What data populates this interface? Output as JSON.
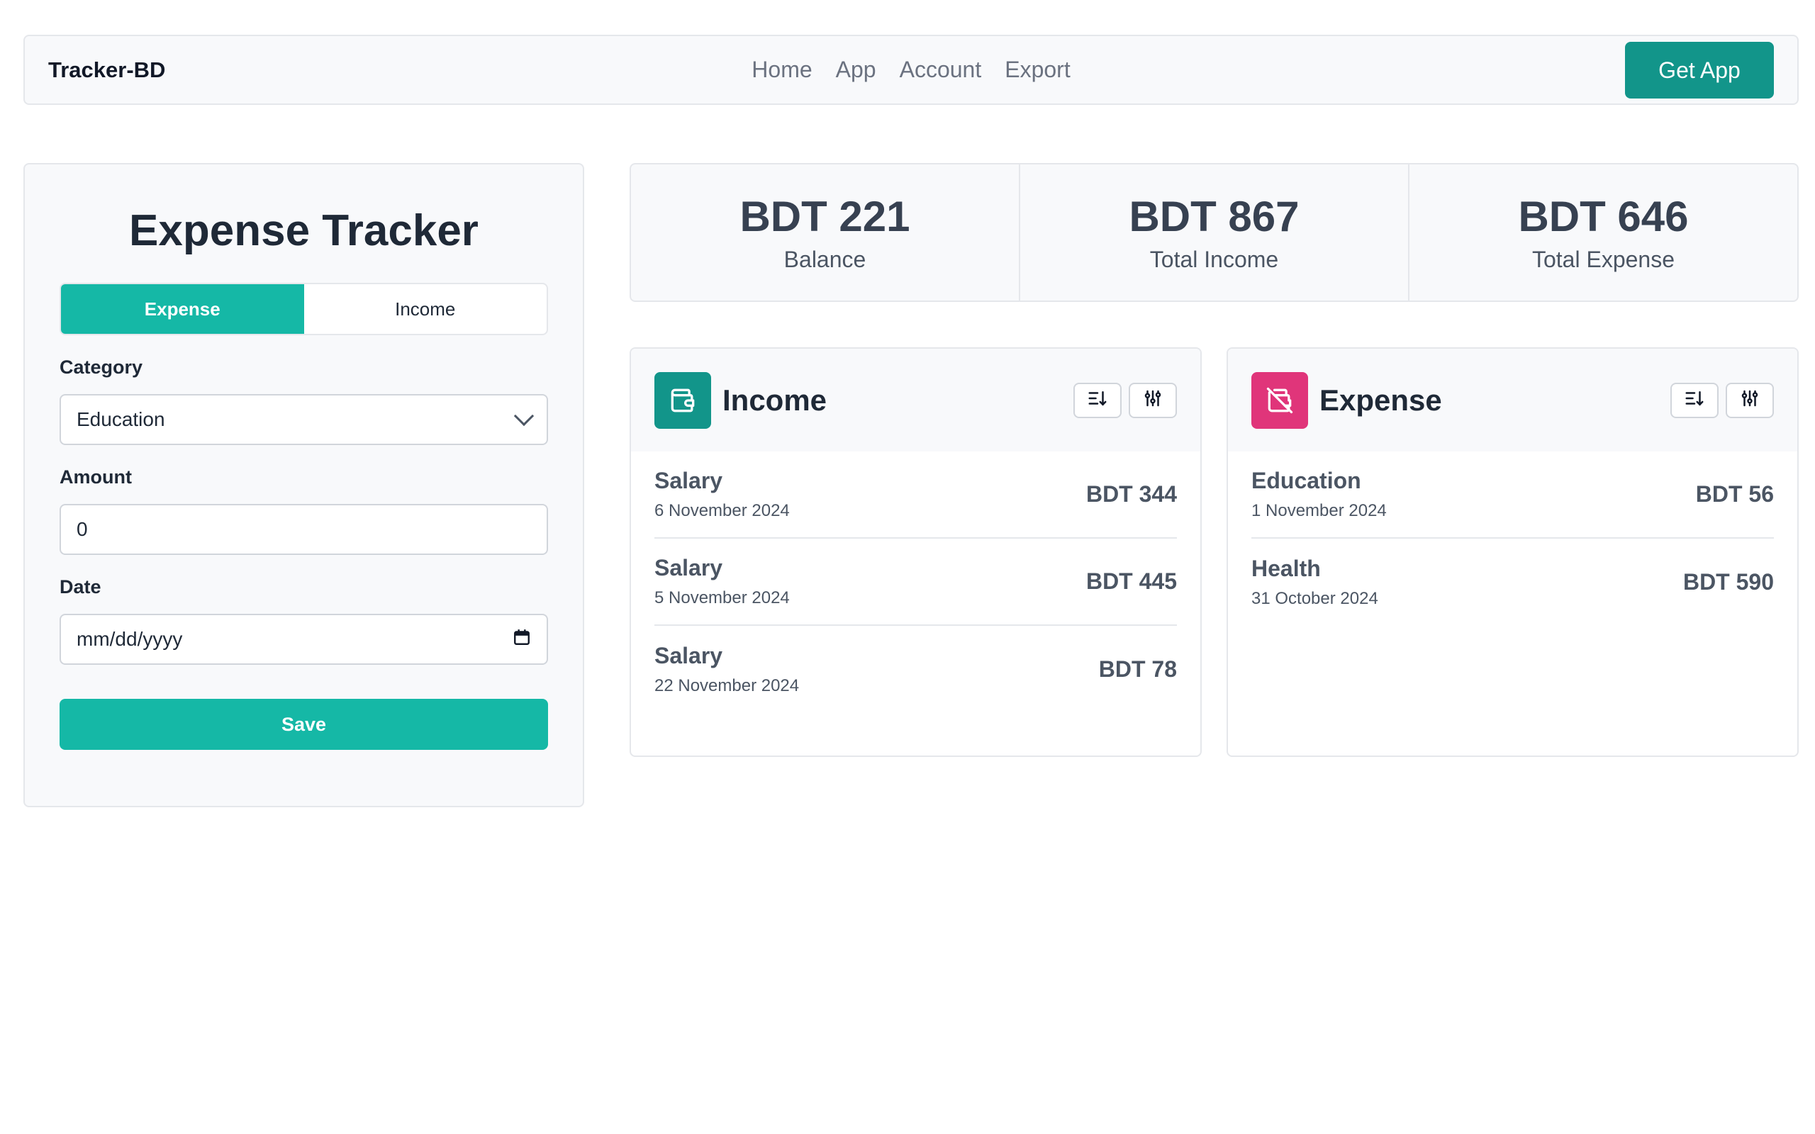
{
  "nav": {
    "brand": "Tracker-BD",
    "links": [
      "Home",
      "App",
      "Account",
      "Export"
    ],
    "cta": "Get App"
  },
  "form": {
    "title": "Expense Tracker",
    "tabs": [
      {
        "label": "Expense",
        "active": true
      },
      {
        "label": "Income",
        "active": false
      }
    ],
    "category_label": "Category",
    "category_value": "Education",
    "amount_label": "Amount",
    "amount_value": "0",
    "date_label": "Date",
    "date_placeholder": "mm/dd/yyyy",
    "save_label": "Save"
  },
  "stats": [
    {
      "value": "BDT 221",
      "label": "Balance"
    },
    {
      "value": "BDT 867",
      "label": "Total Income"
    },
    {
      "value": "BDT 646",
      "label": "Total Expense"
    }
  ],
  "income": {
    "title": "Income",
    "icon": "wallet-icon",
    "icon_color": "#12958a",
    "items": [
      {
        "name": "Salary",
        "date": "6 November 2024",
        "amount": "BDT 344"
      },
      {
        "name": "Salary",
        "date": "5 November 2024",
        "amount": "BDT 445"
      },
      {
        "name": "Salary",
        "date": "22 November 2024",
        "amount": "BDT 78"
      }
    ]
  },
  "expense": {
    "title": "Expense",
    "icon": "wallet-off-icon",
    "icon_color": "#e0357a",
    "items": [
      {
        "name": "Education",
        "date": "1 November 2024",
        "amount": "BDT 56"
      },
      {
        "name": "Health",
        "date": "31 October 2024",
        "amount": "BDT 590"
      }
    ]
  },
  "colors": {
    "accent": "#15b8a6",
    "accent_dark": "#12958a",
    "expense": "#e0357a"
  }
}
